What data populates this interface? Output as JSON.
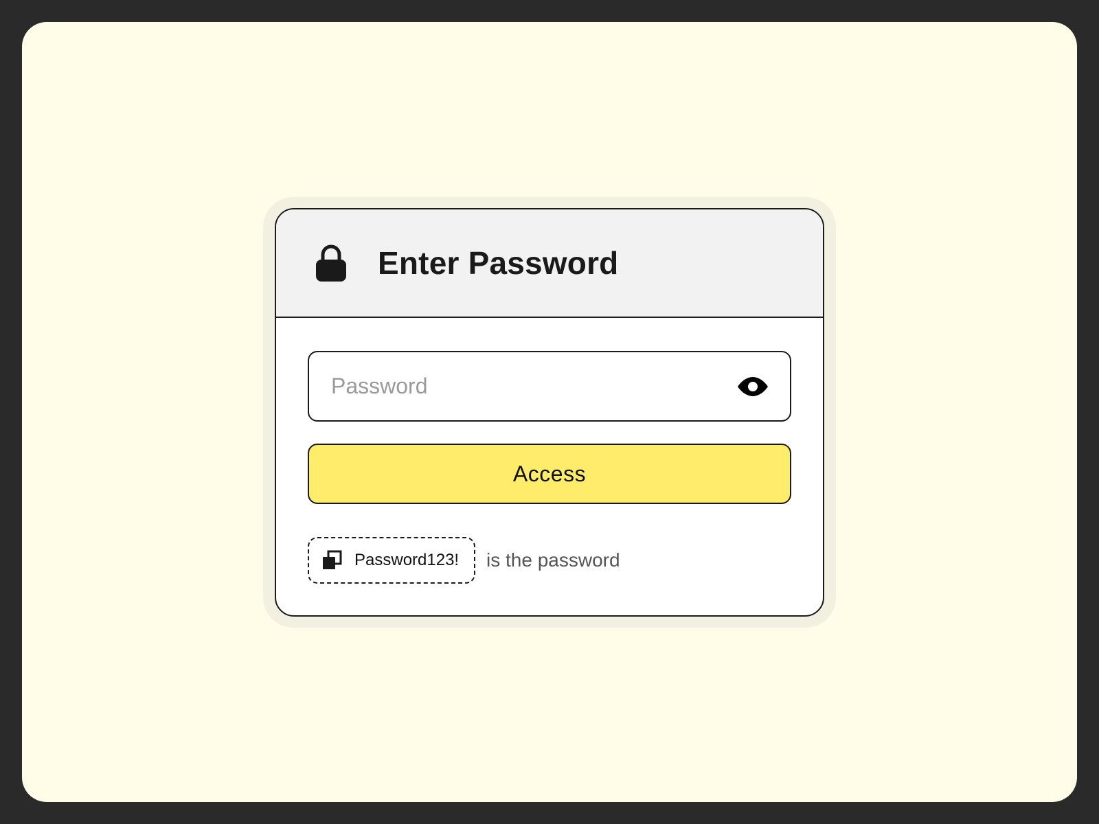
{
  "dialog": {
    "title": "Enter Password",
    "password_field": {
      "placeholder": "Password",
      "value": ""
    },
    "access_button_label": "Access",
    "hint": {
      "password": "Password123!",
      "suffix": "is the password"
    }
  },
  "icons": {
    "header": "lock-icon",
    "visibility_toggle": "eye-icon",
    "copy": "copy-icon"
  },
  "colors": {
    "page_bg": "#fffde8",
    "frame_bg": "#2a2a2a",
    "button_accent": "#ffec6b",
    "header_bg": "#f2f2f2"
  }
}
